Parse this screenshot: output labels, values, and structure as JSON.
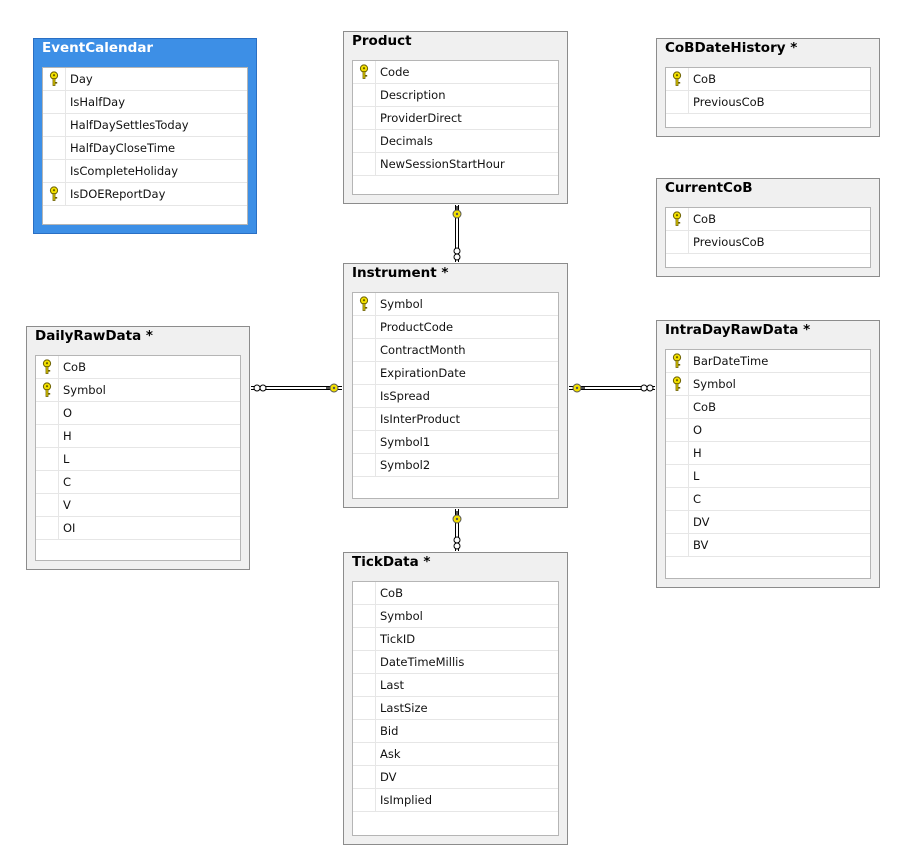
{
  "colors": {
    "selected_header": "#3d8fe6",
    "key_icon": "#e8d200",
    "line": "#000000"
  },
  "tables": {
    "event_calendar": {
      "title": "EventCalendar",
      "columns": [
        {
          "name": "Day",
          "key": true
        },
        {
          "name": "IsHalfDay",
          "key": false
        },
        {
          "name": "HalfDaySettlesToday",
          "key": false
        },
        {
          "name": "HalfDayCloseTime",
          "key": false
        },
        {
          "name": "IsCompleteHoliday",
          "key": false
        },
        {
          "name": "IsDOEReportDay",
          "key": true
        }
      ]
    },
    "product": {
      "title": "Product",
      "columns": [
        {
          "name": "Code",
          "key": true
        },
        {
          "name": "Description",
          "key": false
        },
        {
          "name": "ProviderDirect",
          "key": false
        },
        {
          "name": "Decimals",
          "key": false
        },
        {
          "name": "NewSessionStartHour",
          "key": false
        }
      ]
    },
    "cob_date_history": {
      "title": "CoBDateHistory *",
      "columns": [
        {
          "name": "CoB",
          "key": true
        },
        {
          "name": "PreviousCoB",
          "key": false
        }
      ]
    },
    "current_cob": {
      "title": "CurrentCoB",
      "columns": [
        {
          "name": "CoB",
          "key": true
        },
        {
          "name": "PreviousCoB",
          "key": false
        }
      ]
    },
    "instrument": {
      "title": "Instrument *",
      "columns": [
        {
          "name": "Symbol",
          "key": true
        },
        {
          "name": "ProductCode",
          "key": false
        },
        {
          "name": "ContractMonth",
          "key": false
        },
        {
          "name": "ExpirationDate",
          "key": false
        },
        {
          "name": "IsSpread",
          "key": false
        },
        {
          "name": "IsInterProduct",
          "key": false
        },
        {
          "name": "Symbol1",
          "key": false
        },
        {
          "name": "Symbol2",
          "key": false
        }
      ]
    },
    "daily_raw_data": {
      "title": "DailyRawData *",
      "columns": [
        {
          "name": "CoB",
          "key": true
        },
        {
          "name": "Symbol",
          "key": true
        },
        {
          "name": "O",
          "key": false
        },
        {
          "name": "H",
          "key": false
        },
        {
          "name": "L",
          "key": false
        },
        {
          "name": "C",
          "key": false
        },
        {
          "name": "V",
          "key": false
        },
        {
          "name": "OI",
          "key": false
        }
      ]
    },
    "intraday_raw_data": {
      "title": "IntraDayRawData *",
      "columns": [
        {
          "name": "BarDateTime",
          "key": true
        },
        {
          "name": "Symbol",
          "key": true
        },
        {
          "name": "CoB",
          "key": false
        },
        {
          "name": "O",
          "key": false
        },
        {
          "name": "H",
          "key": false
        },
        {
          "name": "L",
          "key": false
        },
        {
          "name": "C",
          "key": false
        },
        {
          "name": "DV",
          "key": false
        },
        {
          "name": "BV",
          "key": false
        }
      ]
    },
    "tick_data": {
      "title": "TickData *",
      "columns": [
        {
          "name": "CoB",
          "key": false
        },
        {
          "name": "Symbol",
          "key": false
        },
        {
          "name": "TickID",
          "key": false
        },
        {
          "name": "DateTimeMillis",
          "key": false
        },
        {
          "name": "Last",
          "key": false
        },
        {
          "name": "LastSize",
          "key": false
        },
        {
          "name": "Bid",
          "key": false
        },
        {
          "name": "Ask",
          "key": false
        },
        {
          "name": "DV",
          "key": false
        },
        {
          "name": "IsImplied",
          "key": false
        }
      ]
    }
  }
}
